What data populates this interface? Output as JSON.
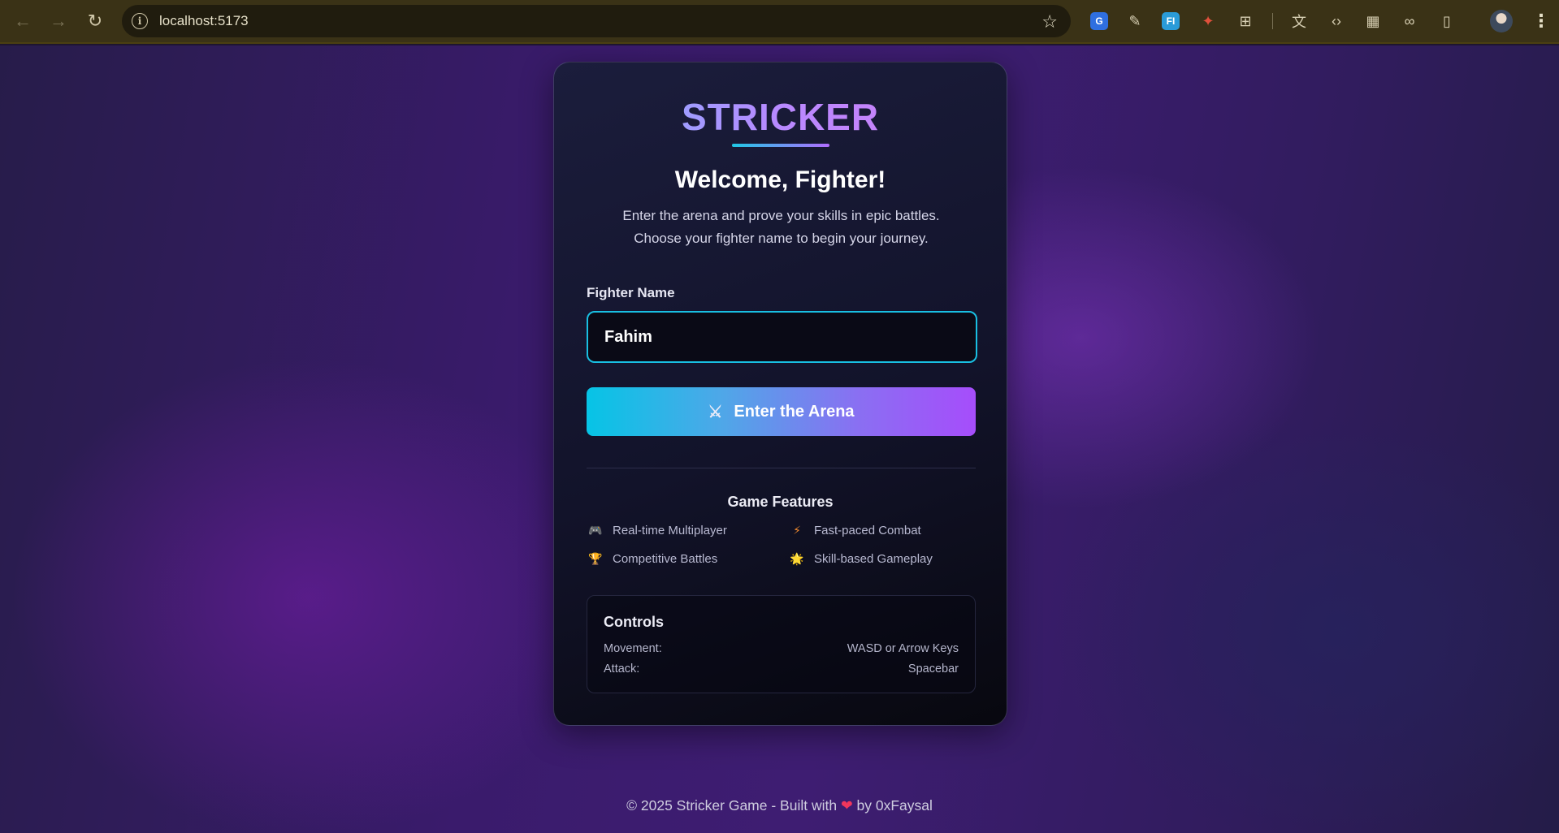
{
  "browser": {
    "url": "localhost:5173",
    "back_icon": "←",
    "forward_icon": "→",
    "reload_icon": "↻",
    "star_icon": "☆",
    "menu_icon": "⋮",
    "extensions": [
      "translate-icon",
      "eyedropper-icon",
      "fi-extension-icon",
      "dragon-extension-icon",
      "puzzle-icon",
      "google-translate-icon",
      "code-icon",
      "table-icon",
      "link-icon",
      "reader-icon"
    ]
  },
  "card": {
    "logo": "STRICKER",
    "welcome": "Welcome, Fighter!",
    "subtitle_line1": "Enter the arena and prove your skills in epic battles.",
    "subtitle_line2": "Choose your fighter name to begin your journey.",
    "name_label": "Fighter Name",
    "name_value": "Fahim",
    "enter_icon": "⚔",
    "enter_label": "Enter the Arena",
    "features_title": "Game Features",
    "features": [
      {
        "icon": "🎮",
        "label": "Real-time Multiplayer"
      },
      {
        "icon": "⚡",
        "label": "Fast-paced Combat"
      },
      {
        "icon": "🏆",
        "label": "Competitive Battles"
      },
      {
        "icon": "🌟",
        "label": "Skill-based Gameplay"
      }
    ],
    "controls_title": "Controls",
    "controls": [
      {
        "label": "Movement:",
        "value": "WASD or Arrow Keys"
      },
      {
        "label": "Attack:",
        "value": "Spacebar"
      }
    ]
  },
  "footer": {
    "prefix": "© 2025 Stricker Game - Built with",
    "heart": "❤",
    "suffix": "by 0xFaysal"
  },
  "colors": {
    "accent_cyan": "#19bfe2",
    "accent_purple": "#a64dfb",
    "card_bg": "#12132a"
  }
}
